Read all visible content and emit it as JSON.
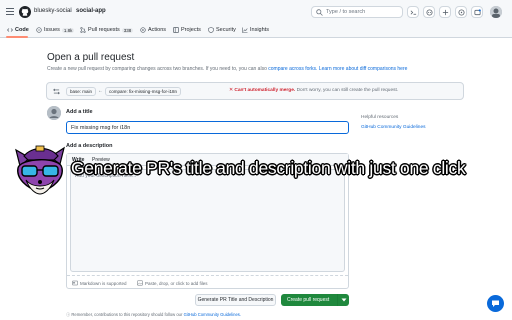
{
  "header": {
    "owner": "bluesky-social",
    "separator": "/",
    "repo": "social-app",
    "search_placeholder": "Type / to search"
  },
  "tabs": [
    {
      "label": "Code",
      "icon": "code-icon"
    },
    {
      "label": "Issues",
      "count": "1.8k",
      "icon": "issue-icon"
    },
    {
      "label": "Pull requests",
      "count": "338",
      "icon": "pr-icon"
    },
    {
      "label": "Actions",
      "icon": "actions-icon"
    },
    {
      "label": "Projects",
      "icon": "projects-icon"
    },
    {
      "label": "Security",
      "icon": "shield-icon"
    },
    {
      "label": "Insights",
      "icon": "graph-icon"
    }
  ],
  "page": {
    "title": "Open a pull request",
    "subtitle_prefix": "Create a new pull request by comparing changes across two branches. If you need to, you can also",
    "subtitle_link1": "compare across forks.",
    "subtitle_link2": "Learn more about diff comparisons here"
  },
  "compare": {
    "base": "base: main",
    "arrow": "←",
    "compare_branch": "compare: fix-missing-msg-for-i18n",
    "warn_strong": "Can't automatically merge.",
    "warn_rest": "Don't worry, you can still create the pull request."
  },
  "form": {
    "title_label": "Add a title",
    "title_value": "Fix missing msg for i18n",
    "desc_label": "Add a description",
    "write_tab": "Write",
    "preview_tab": "Preview",
    "desc_placeholder": "Add your description here...",
    "markdown_note": "Markdown is supported",
    "attach_note": "Paste, drop, or click to add files"
  },
  "buttons": {
    "generate": "Generate PR Title and Description",
    "create": "Create pull request"
  },
  "footnote": {
    "text": "Remember, contributions to this repository should follow our",
    "link": "GitHub Community Guidelines."
  },
  "sidebar": {
    "title": "Helpful resources",
    "link": "GitHub Community Guidelines"
  },
  "overlay": {
    "caption": "Generate PR's title and description with just one click"
  },
  "colors": {
    "accent": "#0969da",
    "create_button": "#1f883d",
    "warning": "#cf222e",
    "tab_underline": "#fd8c73"
  }
}
